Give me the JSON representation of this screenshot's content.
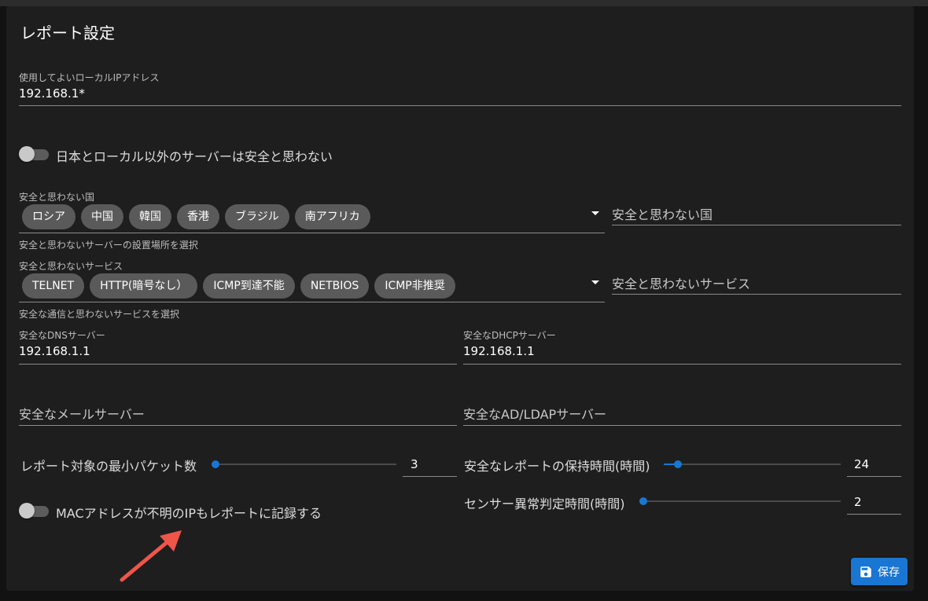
{
  "title": "レポート設定",
  "local_ip": {
    "label": "使用してよいローカルIPアドレス",
    "value": "192.168.1*"
  },
  "switch_foreign": {
    "label": "日本とローカル以外のサーバーは安全と思わない",
    "checked": false
  },
  "unsafe_countries": {
    "label": "安全と思わない国",
    "chips": [
      "ロシア",
      "中国",
      "韓国",
      "香港",
      "ブラジル",
      "南アフリカ"
    ],
    "helper": "安全と思わないサーバーの設置場所を選択",
    "side_placeholder": "安全と思わない国"
  },
  "unsafe_services": {
    "label": "安全と思わないサービス",
    "chips": [
      "TELNET",
      "HTTP(暗号なし）",
      "ICMP到達不能",
      "NETBIOS",
      "ICMP非推奨"
    ],
    "helper": "安全な通信と思わないサービスを選択",
    "side_placeholder": "安全と思わないサービス"
  },
  "dns": {
    "label": "安全なDNSサーバー",
    "value": "192.168.1.1"
  },
  "dhcp": {
    "label": "安全なDHCPサーバー",
    "value": "192.168.1.1"
  },
  "mail": {
    "placeholder": "安全なメールサーバー"
  },
  "ad": {
    "placeholder": "安全なAD/LDAPサーバー"
  },
  "min_packets": {
    "label": "レポート対象の最小パケット数",
    "value": "3",
    "fraction": 0.0
  },
  "retention": {
    "label": "安全なレポートの保持時間(時間)",
    "value": "24",
    "fraction": 0.08
  },
  "sensor": {
    "label": "センサー異常判定時間(時間)",
    "value": "2",
    "fraction": 0.02
  },
  "switch_mac": {
    "label": "MACアドレスが不明のIPもレポートに記録する",
    "checked": false
  },
  "save": {
    "label": "保存",
    "icon": "save-icon"
  },
  "colors": {
    "accent": "#1976d2",
    "annotation_arrow": "#f0554a"
  }
}
